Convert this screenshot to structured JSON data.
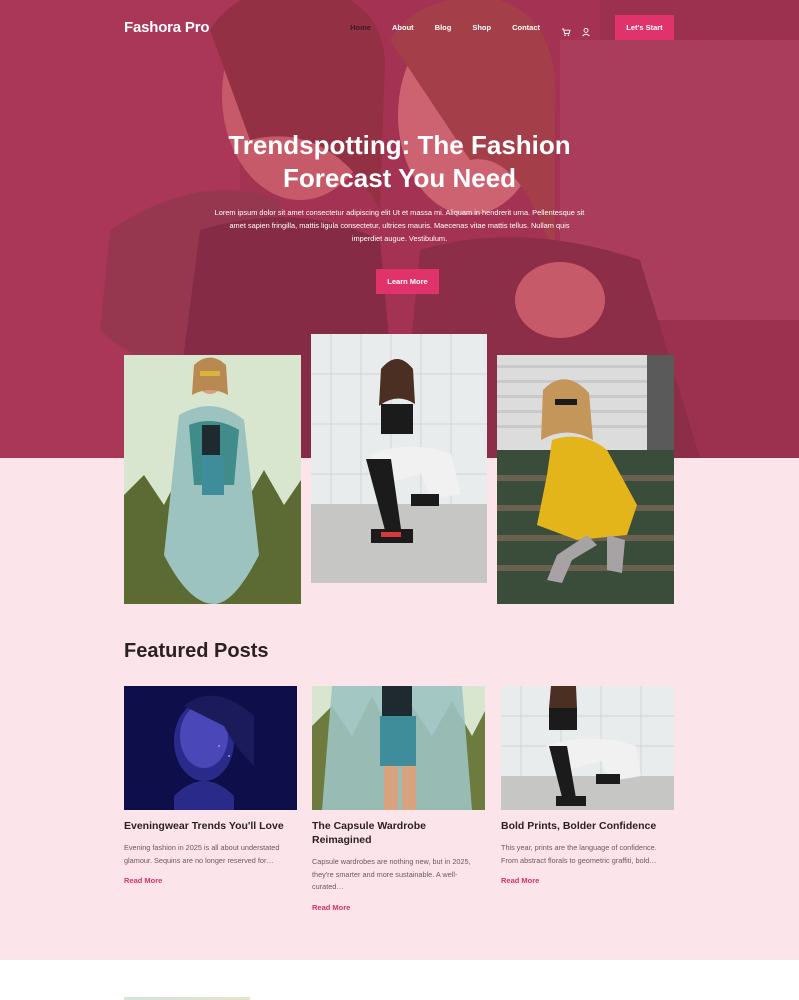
{
  "brand": "Fashora Pro",
  "nav": {
    "items": [
      "Home",
      "About",
      "Blog",
      "Shop",
      "Contact"
    ],
    "active": "Home",
    "icons": [
      "cart-icon",
      "user-icon"
    ],
    "cta": "Let's Start"
  },
  "hero": {
    "title": "Trendspotting: The Fashion Forecast You Need",
    "text": "Lorem ipsum dolor sit amet consectetur adipiscing elit Ut et massa mi. Aliquam in hendrerit urna. Pellentesque sit amet sapien fringilla, mattis ligula consectetur, ultrices mauris. Maecenas vitae mattis tellus. Nullam quis imperdiet augue. Vestibulum.",
    "button": "Learn More"
  },
  "featured": {
    "title": "Featured Posts",
    "posts": [
      {
        "title": "Eveningwear Trends You'll Love",
        "excerpt": "Evening fashion in 2025 is all about understated glamour. Sequins are no longer reserved for…",
        "link": "Read More"
      },
      {
        "title": "The Capsule Wardrobe Reimagined",
        "excerpt": "Capsule wardrobes are nothing new, but in 2025, they're smarter and more sustainable. A well-curated…",
        "link": "Read More"
      },
      {
        "title": "Bold Prints, Bolder Confidence",
        "excerpt": "This year, prints are the language of confidence. From abstract florals to geometric graffiti, bold…",
        "link": "Read More"
      }
    ]
  },
  "colors": {
    "accent": "#e0336b",
    "hero_overlay": "#c43460",
    "page_bg": "#fbe4ea",
    "link": "#d63366"
  }
}
